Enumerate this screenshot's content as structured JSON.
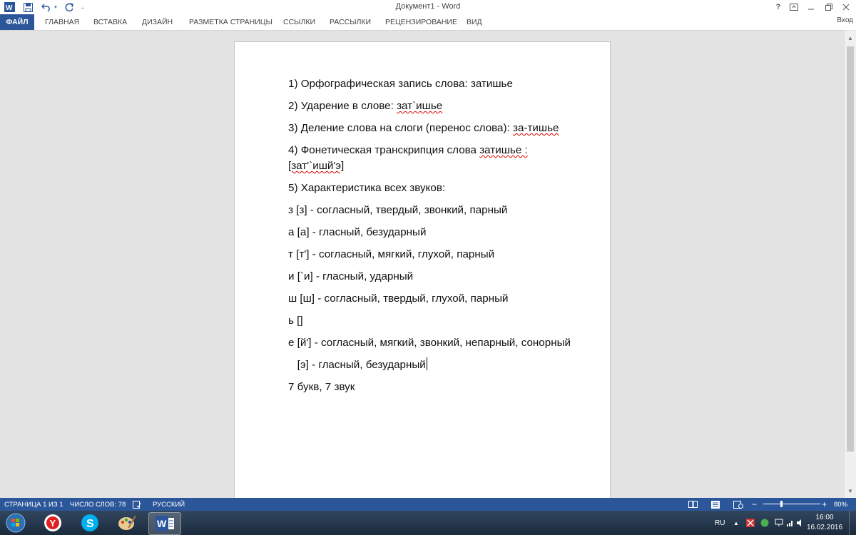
{
  "window": {
    "title": "Документ1 - Word",
    "help": "?",
    "sign_in": "Вход"
  },
  "ribbon": {
    "tabs": [
      "ФАЙЛ",
      "ГЛАВНАЯ",
      "ВСТАВКА",
      "ДИЗАЙН",
      "РАЗМЕТКА СТРАНИЦЫ",
      "ССЫЛКИ",
      "РАССЫЛКИ",
      "РЕЦЕНЗИРОВАНИЕ",
      "ВИД"
    ]
  },
  "document": {
    "p1": "1) Орфографическая запись слова: затишье",
    "p2_prefix": "2) Ударение в слове: ",
    "p2_word": "зат`ишье",
    "p3_prefix": "3) Деление слова на слоги (перенос слова): ",
    "p3_word": "за-тишье",
    "p4_prefix": "4) Фонетическая транскрипция слова ",
    "p4_word": "затишье :",
    "p4_trans_word": "[зат'`ишй'э]",
    "p5": "5) Характеристика всех звуков:",
    "s1": "з [з] - согласный, твердый, звонкий, парный",
    "s2": "а [а] - гласный, безударный",
    "s3": "т [т'] - согласный, мягкий, глухой, парный",
    "s4": "и [`и] - гласный, ударный",
    "s5": "ш [ш] - согласный, твердый, глухой, парный",
    "s6": "ь []",
    "s7": "е [й'] - согласный, мягкий, звонкий, непарный, сонорный",
    "s8": "   [э] - гласный, безударный",
    "summary": "7 букв, 7 звук"
  },
  "statusbar": {
    "page": "СТРАНИЦА 1 ИЗ 1",
    "words": "ЧИСЛО СЛОВ: 78",
    "language": "РУССКИЙ",
    "zoom": "80%",
    "zoom_minus": "−",
    "zoom_plus": "+"
  },
  "taskbar": {
    "lang": "RU",
    "time": "16:00",
    "date": "16.02.2016"
  },
  "colors": {
    "accent": "#2b579a",
    "squiggle": "#dd0000"
  },
  "icons": [
    "word-logo-icon",
    "save-icon",
    "undo-icon",
    "redo-icon",
    "customize-icon",
    "help-icon",
    "ribbon-options-icon",
    "minimize-icon",
    "restore-icon",
    "close-icon",
    "start-icon",
    "yandex-icon",
    "skype-icon",
    "paint-icon",
    "word-taskbar-icon"
  ]
}
